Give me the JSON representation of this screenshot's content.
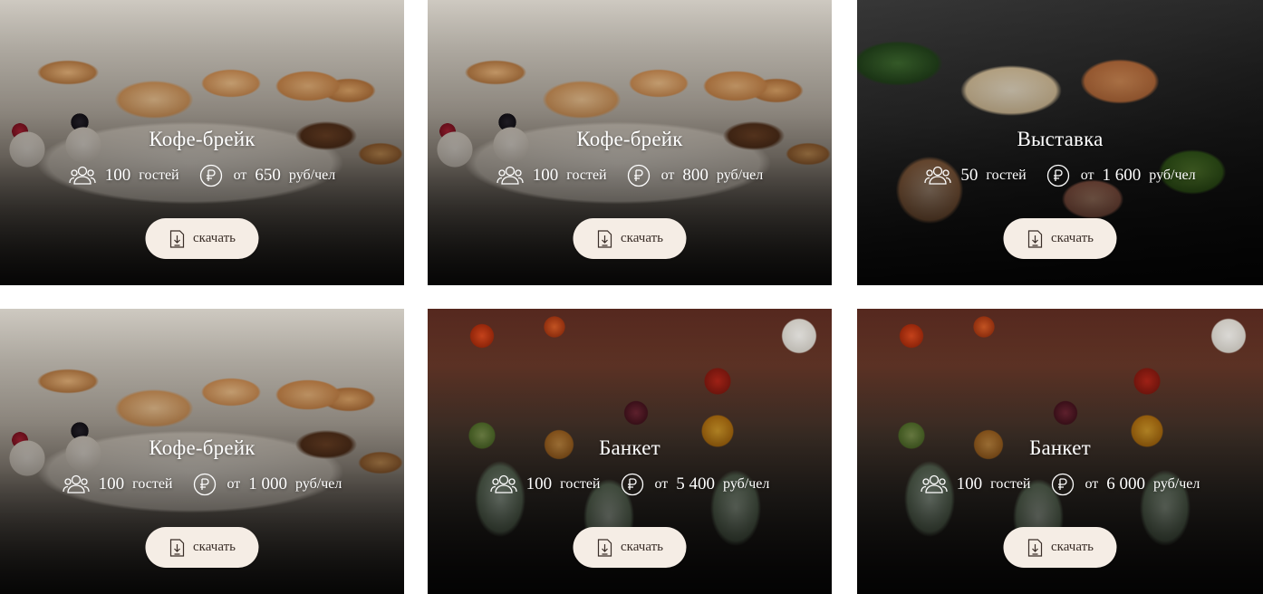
{
  "cards": [
    {
      "title": "Кофе-брейк",
      "guests": "100",
      "guests_label": "гостей",
      "price_prefix": "от",
      "price": "650",
      "price_unit": "руб/чел",
      "button_label": "скачать",
      "photo": "pastry-icon"
    },
    {
      "title": "Кофе-брейк",
      "guests": "100",
      "guests_label": "гостей",
      "price_prefix": "от",
      "price": "800",
      "price_unit": "руб/чел",
      "button_label": "скачать",
      "photo": "pastry-icon"
    },
    {
      "title": "Выставка",
      "guests": "50",
      "guests_label": "гостей",
      "price_prefix": "от",
      "price": "1 600",
      "price_unit": "руб/чел",
      "button_label": "скачать",
      "photo": "food-boxes-icon"
    },
    {
      "title": "Кофе-брейк",
      "guests": "100",
      "guests_label": "гостей",
      "price_prefix": "от",
      "price": "1 000",
      "price_unit": "руб/чел",
      "button_label": "скачать",
      "photo": "pastry-icon"
    },
    {
      "title": "Банкет",
      "guests": "100",
      "guests_label": "гостей",
      "price_prefix": "от",
      "price": "5 400",
      "price_unit": "руб/чел",
      "button_label": "скачать",
      "photo": "verrines-icon"
    },
    {
      "title": "Банкет",
      "guests": "100",
      "guests_label": "гостей",
      "price_prefix": "от",
      "price": "6 000",
      "price_unit": "руб/чел",
      "button_label": "скачать",
      "photo": "verrines-icon"
    }
  ],
  "icons": {
    "guests": "people-icon",
    "price": "ruble-icon",
    "download": "download-file-icon"
  },
  "colors": {
    "button_bg": "#f5ede5",
    "button_text": "#3a2e28",
    "text": "#ffffff"
  }
}
